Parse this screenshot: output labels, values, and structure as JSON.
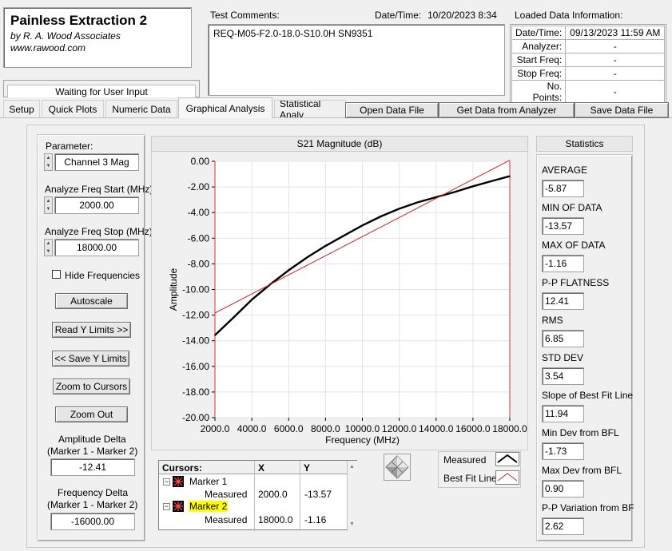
{
  "header": {
    "app_title": "Painless Extraction 2",
    "company": "by R. A. Wood Associates",
    "website": "www.rawood.com",
    "status": "Waiting for User Input"
  },
  "test": {
    "comments_label": "Test Comments:",
    "comments_value": "REQ-M05-F2.0-18.0-S10.0H   SN9351",
    "datetime_label": "Date/Time:",
    "datetime_value": "10/20/2023  8:34"
  },
  "loaded_info": {
    "title": "Loaded Data Information:",
    "rows": [
      {
        "key": "Date/Time:",
        "value": "09/13/2023 11:59 AM"
      },
      {
        "key": "Analyzer:",
        "value": "-"
      },
      {
        "key": "Start Freq:",
        "value": "-"
      },
      {
        "key": "Stop Freq:",
        "value": "-"
      },
      {
        "key": "No. Points:",
        "value": "-"
      }
    ]
  },
  "tabs": [
    {
      "label": "Setup"
    },
    {
      "label": "Quick Plots"
    },
    {
      "label": "Numeric Data"
    },
    {
      "label": "Graphical Analysis"
    },
    {
      "label": "Statistical Analy"
    }
  ],
  "toolbar": {
    "open": "Open Data File",
    "get": "Get Data from Analyzer",
    "save": "Save Data File"
  },
  "left_panel": {
    "parameter_label": "Parameter:",
    "parameter_value": "Channel 3 Mag",
    "start_label": "Analyze Freq Start (MHz)",
    "start_value": "2000.00",
    "stop_label": "Analyze Freq Stop (MHz)",
    "stop_value": "18000.00",
    "hide_freq_label": "Hide Frequencies",
    "autoscale": "Autoscale",
    "read_y": "Read Y Limits >>",
    "save_y": "<< Save Y Limits",
    "zoom_cursors": "Zoom to Cursors",
    "zoom_out": "Zoom Out",
    "amp_delta_label_1": "Amplitude Delta",
    "amp_delta_label_2": "(Marker 1 - Marker 2)",
    "amp_delta_value": "-12.41",
    "freq_delta_label_1": "Frequency Delta",
    "freq_delta_label_2": "(Marker 1 - Marker 2)",
    "freq_delta_value": "-16000.00"
  },
  "cursors": {
    "header": {
      "name": "Cursors:",
      "x": "X",
      "y": "Y"
    },
    "marker1": {
      "name": "Marker 1",
      "sub": "Measured",
      "x": "2000.0",
      "y": "-13.57"
    },
    "marker2": {
      "name": "Marker 2",
      "sub": "Measured",
      "x": "18000.0",
      "y": "-1.16"
    }
  },
  "legend": {
    "measured": "Measured",
    "best_fit": "Best Fit Line"
  },
  "statistics": {
    "title": "Statistics",
    "items": [
      {
        "label": "AVERAGE",
        "value": "-5.87"
      },
      {
        "label": "MIN OF DATA",
        "value": "-13.57"
      },
      {
        "label": "MAX OF DATA",
        "value": "-1.16"
      },
      {
        "label": "P-P FLATNESS",
        "value": "12.41"
      },
      {
        "label": "RMS",
        "value": "6.85"
      },
      {
        "label": "STD DEV",
        "value": "3.54"
      },
      {
        "label": "Slope of Best Fit Line",
        "value": "11.94"
      },
      {
        "label": "Min Dev from BFL",
        "value": "-1.73"
      },
      {
        "label": "Max Dev from BFL",
        "value": "0.90"
      },
      {
        "label": "P-P Variation from BF",
        "value": "2.62"
      }
    ]
  },
  "colors": {
    "measured_line": "#000000",
    "best_fit_line": "#d42020",
    "marker2_highlight": "#ffff00"
  },
  "chart_data": {
    "type": "line",
    "title": "S21 Magnitude (dB)",
    "xlabel": "Frequency (MHz)",
    "ylabel": "Amplitude",
    "xlim": [
      2000,
      18000
    ],
    "ylim": [
      -20,
      0
    ],
    "x_ticks": [
      "2000.0",
      "4000.0",
      "6000.0",
      "8000.0",
      "10000.0",
      "12000.0",
      "14000.0",
      "16000.0",
      "18000.0"
    ],
    "y_ticks": [
      "0.00",
      "-2.00",
      "-4.00",
      "-6.00",
      "-8.00",
      "-10.00",
      "-12.00",
      "-14.00",
      "-16.00",
      "-18.00",
      "-20.00"
    ],
    "grid": true,
    "series": [
      {
        "name": "Measured",
        "x": [
          2000,
          3000,
          4000,
          5000,
          6000,
          7000,
          8000,
          9000,
          10000,
          11000,
          12000,
          13000,
          14000,
          15000,
          16000,
          17000,
          18000
        ],
        "y": [
          -13.57,
          -12.2,
          -10.8,
          -9.6,
          -8.5,
          -7.5,
          -6.6,
          -5.8,
          -5.0,
          -4.3,
          -3.7,
          -3.2,
          -2.8,
          -2.4,
          -1.95,
          -1.55,
          -1.16
        ]
      },
      {
        "name": "Best Fit Line",
        "x": [
          2000,
          18000
        ],
        "y": [
          -11.84,
          0.09
        ]
      }
    ]
  }
}
